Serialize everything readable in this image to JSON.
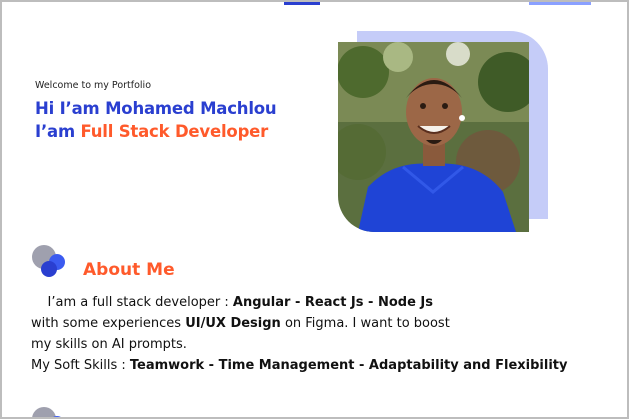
{
  "hero": {
    "welcome": "Welcome to my Portfolio",
    "greeting": "Hi I’am Mohamed Machlou",
    "role_prefix": "I’am ",
    "role_accent": "Full Stack Developer"
  },
  "about": {
    "title": "About Me",
    "line1_prefix": "I’am a full stack developer : ",
    "line1_strong": "Angular - React Js - Node Js",
    "line2_prefix": "with some experiences ",
    "line2_strong": "UI/UX Design",
    "line2_suffix": " on Figma. I want to boost",
    "line3": "my skills on AI prompts.",
    "line4_prefix": "My Soft Skills : ",
    "line4_strong": "Teamwork - Time Management - Adaptability and Flexibility"
  },
  "colors": {
    "primary": "#2a3fd0",
    "accent": "#ff5a2b",
    "photo_frame": "#c5ccf8"
  },
  "icons": {
    "profile_photo": "portrait-photo",
    "section_mark": "circles-icon"
  }
}
